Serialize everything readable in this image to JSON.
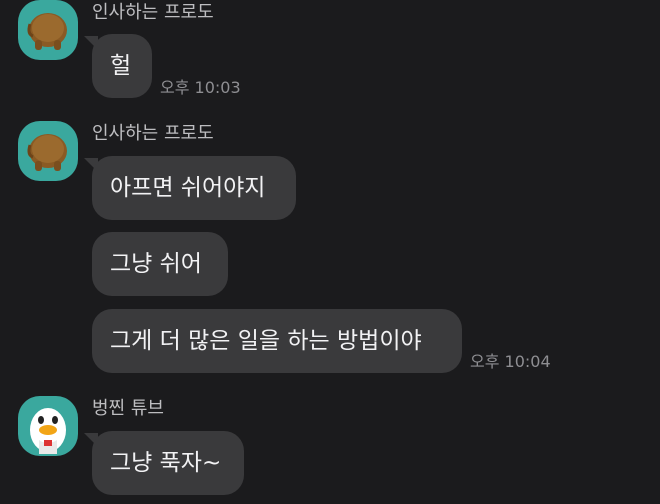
{
  "colors": {
    "background": "#1b1b1d",
    "bubble": "#3a3a3c",
    "avatar_teal": "#3aa89e",
    "text": "#f2f2f4",
    "meta_text": "#8e8e92"
  },
  "messages": [
    {
      "sender": "인사하는 프로도",
      "avatar_icon": "frodo-dog-avatar-icon",
      "bubbles": [
        "헐"
      ],
      "time": "오후 10:03"
    },
    {
      "sender": "인사하는 프로도",
      "avatar_icon": "frodo-dog-avatar-icon",
      "bubbles": [
        "아프면 쉬어야지",
        "그냥 쉬어",
        "그게 더 많은 일을 하는 방법이야"
      ],
      "time": "오후 10:04"
    },
    {
      "sender": "벙찐 튜브",
      "avatar_icon": "tube-duck-avatar-icon",
      "bubbles": [
        "그냥 푹자~"
      ],
      "time": ""
    }
  ]
}
